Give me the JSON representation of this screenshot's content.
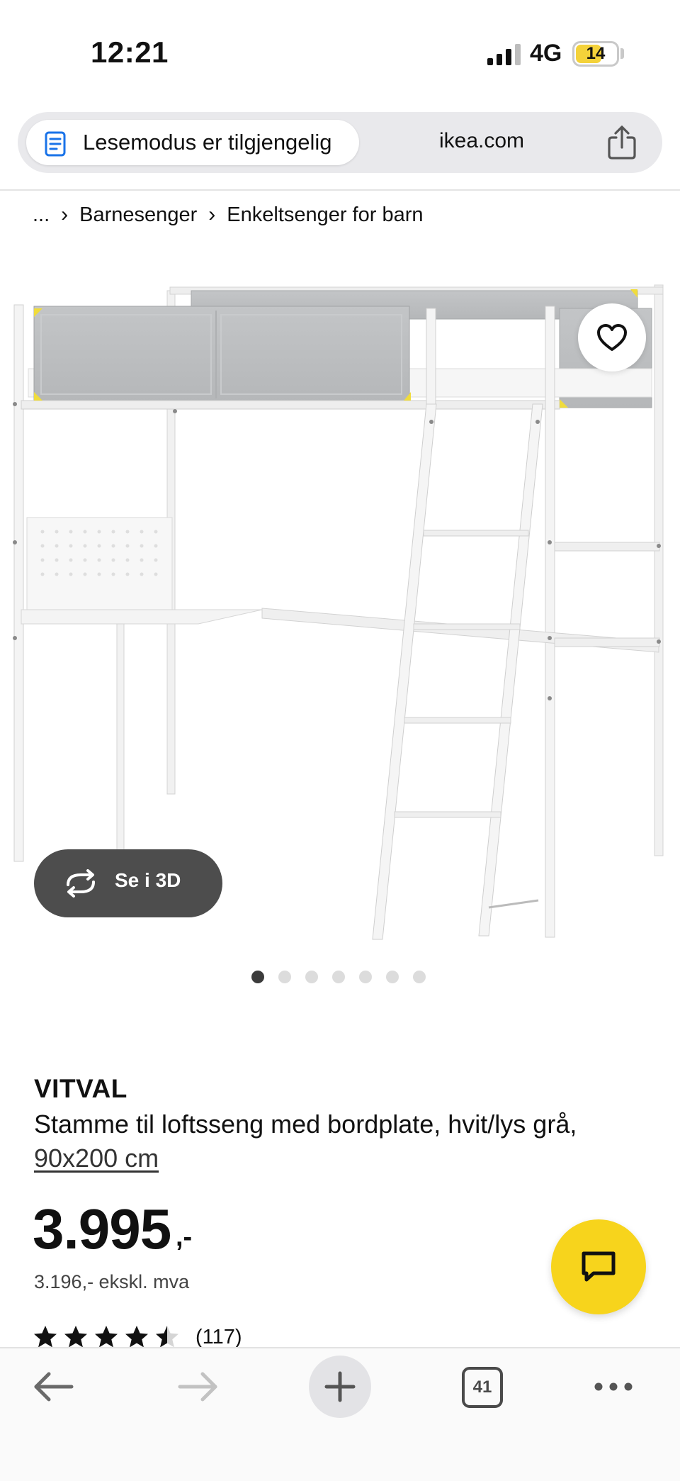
{
  "status_bar": {
    "time": "12:21",
    "network": "4G",
    "battery": "14",
    "battery_level": 0.14
  },
  "url_bar": {
    "reader_mode_label": "Lesemodus er tilgjengelig",
    "domain": "ikea.com"
  },
  "breadcrumb": {
    "items": [
      "...",
      "Barnesenger",
      "Enkeltsenger for barn"
    ]
  },
  "gallery": {
    "view_3d_label": "Se i 3D",
    "slide_count": 7,
    "active_slide": 1
  },
  "product": {
    "brand": "VITVAL",
    "description": "Stamme til loftsseng med bordplate, hvit/lys grå,",
    "size_link": "90x200 cm",
    "price": "3.995",
    "price_suffix": ",-",
    "price_ex_vat": "3.196,- ekskl. mva",
    "rating": 4.5,
    "review_count": "(117)"
  },
  "toolbar": {
    "tab_count": "41"
  },
  "colors": {
    "accent_yellow": "#f7d41c",
    "button_dark": "#4d4d4d",
    "url_bar_bg": "#e9e9ec"
  }
}
